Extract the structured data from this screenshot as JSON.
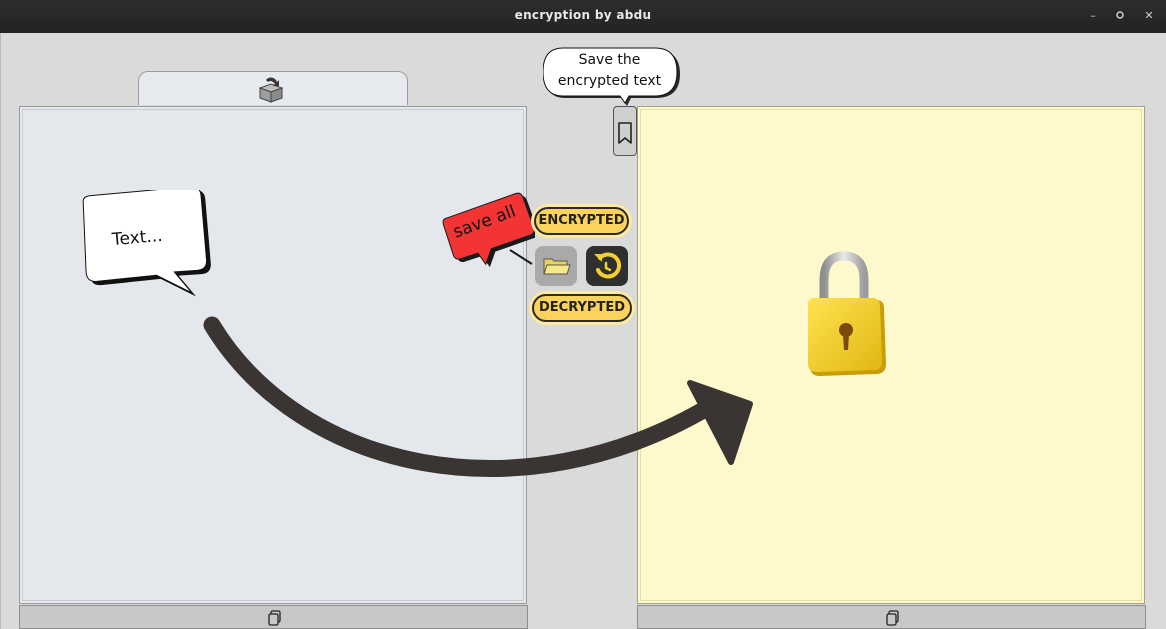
{
  "window": {
    "title": "encryption by abdu",
    "controls": {
      "minimize": "–",
      "restore": "⟳",
      "close": "✕"
    }
  },
  "left": {
    "bubble_text": "Text..."
  },
  "center": {
    "save_tooltip_line1": "Save the",
    "save_tooltip_line2": "encrypted text",
    "save_all_label": "save all",
    "encrypted_label": "ENCRYPTED",
    "decrypted_label": "DECRYPTED"
  },
  "colors": {
    "left_panel_bg": "#e4e8ed",
    "right_panel_bg": "#fef9cc",
    "pill_bg": "#f9d35d",
    "save_all_bg": "#f23434",
    "arrow": "#3a3532",
    "lock_body": "#f2cf2c"
  },
  "icons": {
    "top_tab": "open-box-icon",
    "bottom_left": "copy-icon",
    "bottom_right": "copy-icon",
    "bookmark": "bookmark-icon",
    "open": "folder-icon",
    "reset": "reset-icon",
    "decoration": "padlock-icon"
  }
}
